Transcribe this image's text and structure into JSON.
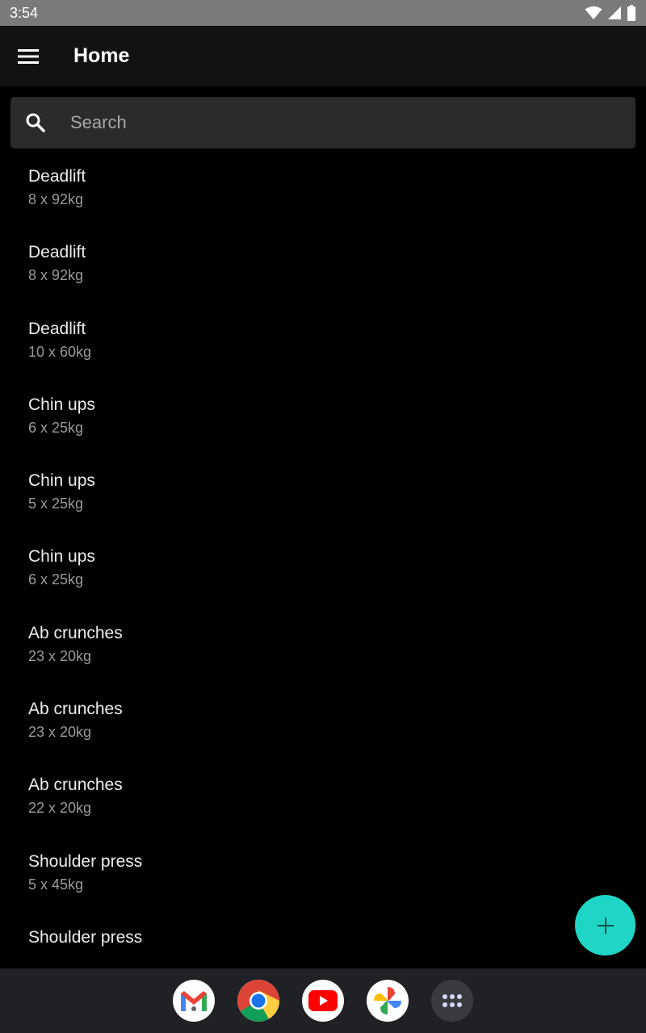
{
  "status_bar": {
    "time": "3:54"
  },
  "app_bar": {
    "title": "Home"
  },
  "search": {
    "placeholder": "Search"
  },
  "exercises": [
    {
      "name": "Deadlift",
      "detail": "8 x 92kg"
    },
    {
      "name": "Deadlift",
      "detail": "8 x 92kg"
    },
    {
      "name": "Deadlift",
      "detail": "10 x 60kg"
    },
    {
      "name": "Chin ups",
      "detail": "6 x 25kg"
    },
    {
      "name": "Chin ups",
      "detail": "5 x 25kg"
    },
    {
      "name": "Chin ups",
      "detail": "6 x 25kg"
    },
    {
      "name": "Ab crunches",
      "detail": "23 x 20kg"
    },
    {
      "name": "Ab crunches",
      "detail": "23 x 20kg"
    },
    {
      "name": "Ab crunches",
      "detail": "22 x 20kg"
    },
    {
      "name": "Shoulder press",
      "detail": "5 x 45kg"
    },
    {
      "name": "Shoulder press",
      "detail": ""
    }
  ],
  "dock": {
    "apps": [
      "gmail-icon",
      "chrome-icon",
      "youtube-icon",
      "photos-icon",
      "app-drawer-icon"
    ]
  },
  "colors": {
    "fab": "#1fd6c6",
    "app_bar": "#121212",
    "search_bg": "#2b2b2b",
    "status_bar": "#7a7a7a"
  }
}
